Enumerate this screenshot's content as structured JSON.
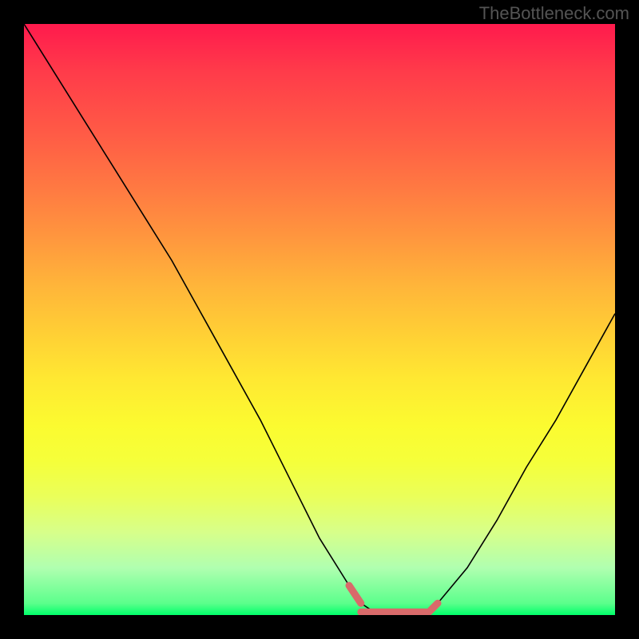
{
  "watermark": "TheBottleneck.com",
  "chart_data": {
    "type": "line",
    "title": "",
    "xlabel": "",
    "ylabel": "",
    "xlim": [
      0,
      100
    ],
    "ylim": [
      0,
      100
    ],
    "grid": false,
    "legend": false,
    "series": [
      {
        "name": "curve",
        "color": "#000000",
        "x": [
          0,
          5,
          10,
          15,
          20,
          25,
          30,
          35,
          40,
          45,
          50,
          55,
          57,
          60,
          63,
          65,
          68,
          70,
          75,
          80,
          85,
          90,
          95,
          100
        ],
        "y": [
          100,
          92,
          84,
          76,
          68,
          60,
          51,
          42,
          33,
          23,
          13,
          5,
          2,
          0,
          0,
          0,
          0,
          2,
          8,
          16,
          25,
          33,
          42,
          51
        ]
      }
    ],
    "highlight_segments": [
      {
        "x": [
          55,
          57
        ],
        "y": [
          5,
          2
        ],
        "color": "#d96a6a"
      },
      {
        "x": [
          57,
          68
        ],
        "y": [
          0.5,
          0.5
        ],
        "color": "#d96a6a"
      },
      {
        "x": [
          68,
          70
        ],
        "y": [
          0,
          2
        ],
        "color": "#d96a6a"
      }
    ]
  }
}
